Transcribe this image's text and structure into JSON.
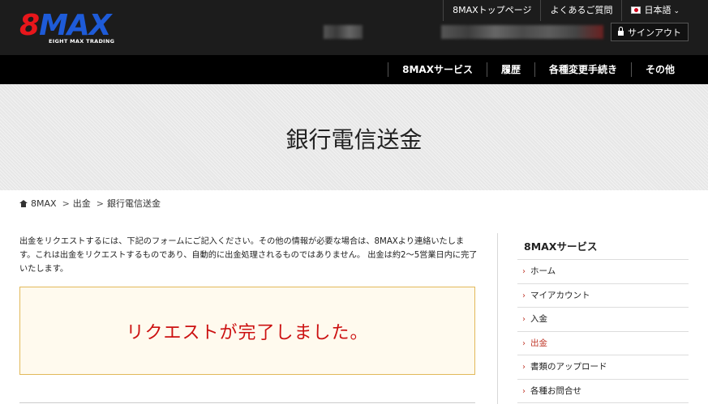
{
  "header": {
    "logo_main_a": "8",
    "logo_main_b": "MAX",
    "logo_sub": "EIGHT MAX TRADING",
    "top_links": [
      "8MAXトップページ",
      "よくあるご質問"
    ],
    "language": "日本語",
    "signout_label": "サインアウト"
  },
  "nav": {
    "items": [
      "8MAXサービス",
      "履歴",
      "各種変更手続き",
      "その他"
    ]
  },
  "hero": {
    "title": "銀行電信送金"
  },
  "breadcrumb": {
    "items": [
      "8MAX",
      "出金",
      "銀行電信送金"
    ]
  },
  "main": {
    "intro": "出金をリクエストするには、下記のフォームにご記入ください。その他の情報が必要な場合は、8MAXより連絡いたします。これは出金をリクエストするものであり、自動的に出金処理されるものではありません。 出金は約2～5営業日内に完了いたします。",
    "notice": "リクエストが完了しました。"
  },
  "sidebar": {
    "title": "8MAXサービス",
    "items": [
      "ホーム",
      "マイアカウント",
      "入金",
      "出金",
      "書類のアップロード",
      "各種お問合せ"
    ],
    "active_index": 3
  },
  "colors": {
    "accent_red": "#cc1111",
    "logo_red": "#e8161b",
    "logo_blue": "#1e5bd8",
    "notice_bg": "#fffaee",
    "notice_border": "#e2b95a"
  }
}
